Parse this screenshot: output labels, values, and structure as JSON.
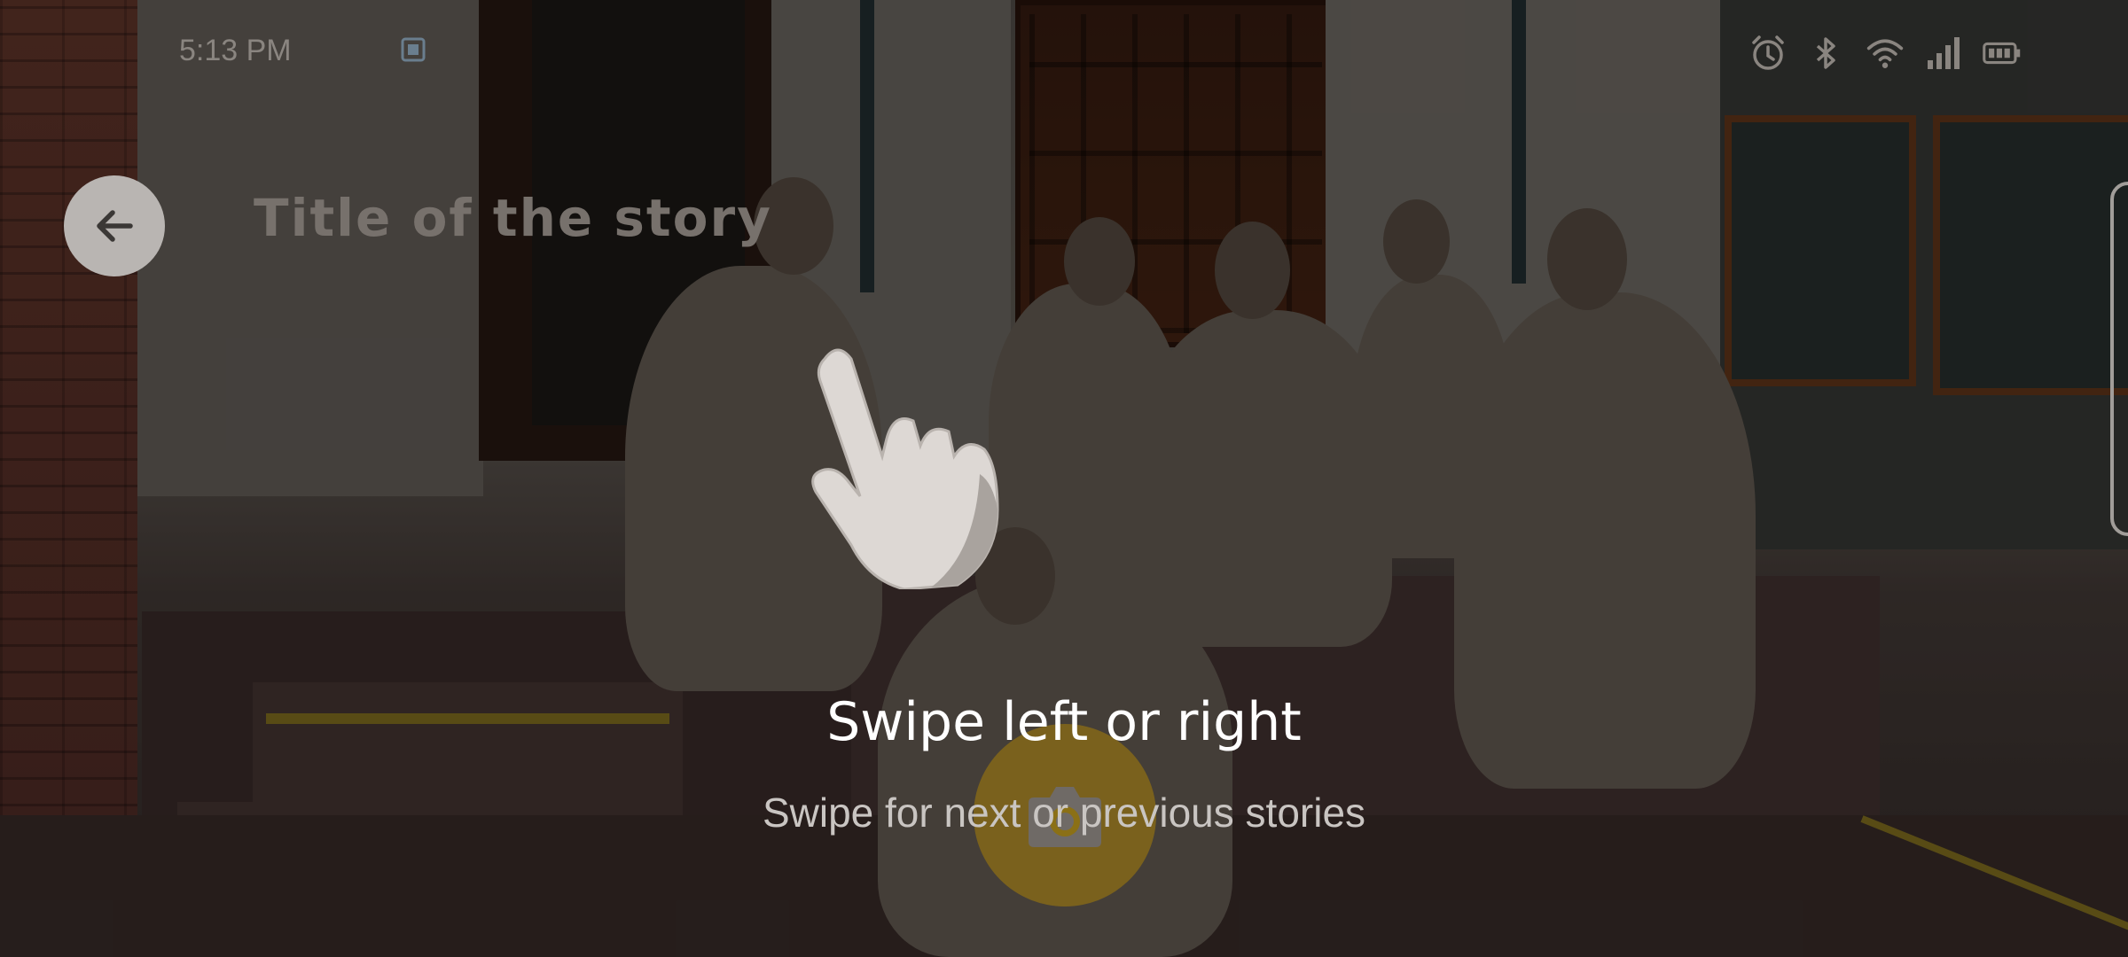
{
  "status_bar": {
    "time": "5:13 PM",
    "icons": [
      "alarm-icon",
      "bluetooth-icon",
      "wifi-icon",
      "signal-icon",
      "battery-icon"
    ]
  },
  "header": {
    "back_icon": "arrow-left-icon",
    "title": "Title of the story"
  },
  "swipe_hint": {
    "icon": "hand-pointer-icon",
    "title": "Swipe left or right",
    "subtitle": "Swipe for next or previous stories"
  },
  "camera_button": {
    "icon": "camera-icon",
    "color": "#8c6e14"
  }
}
